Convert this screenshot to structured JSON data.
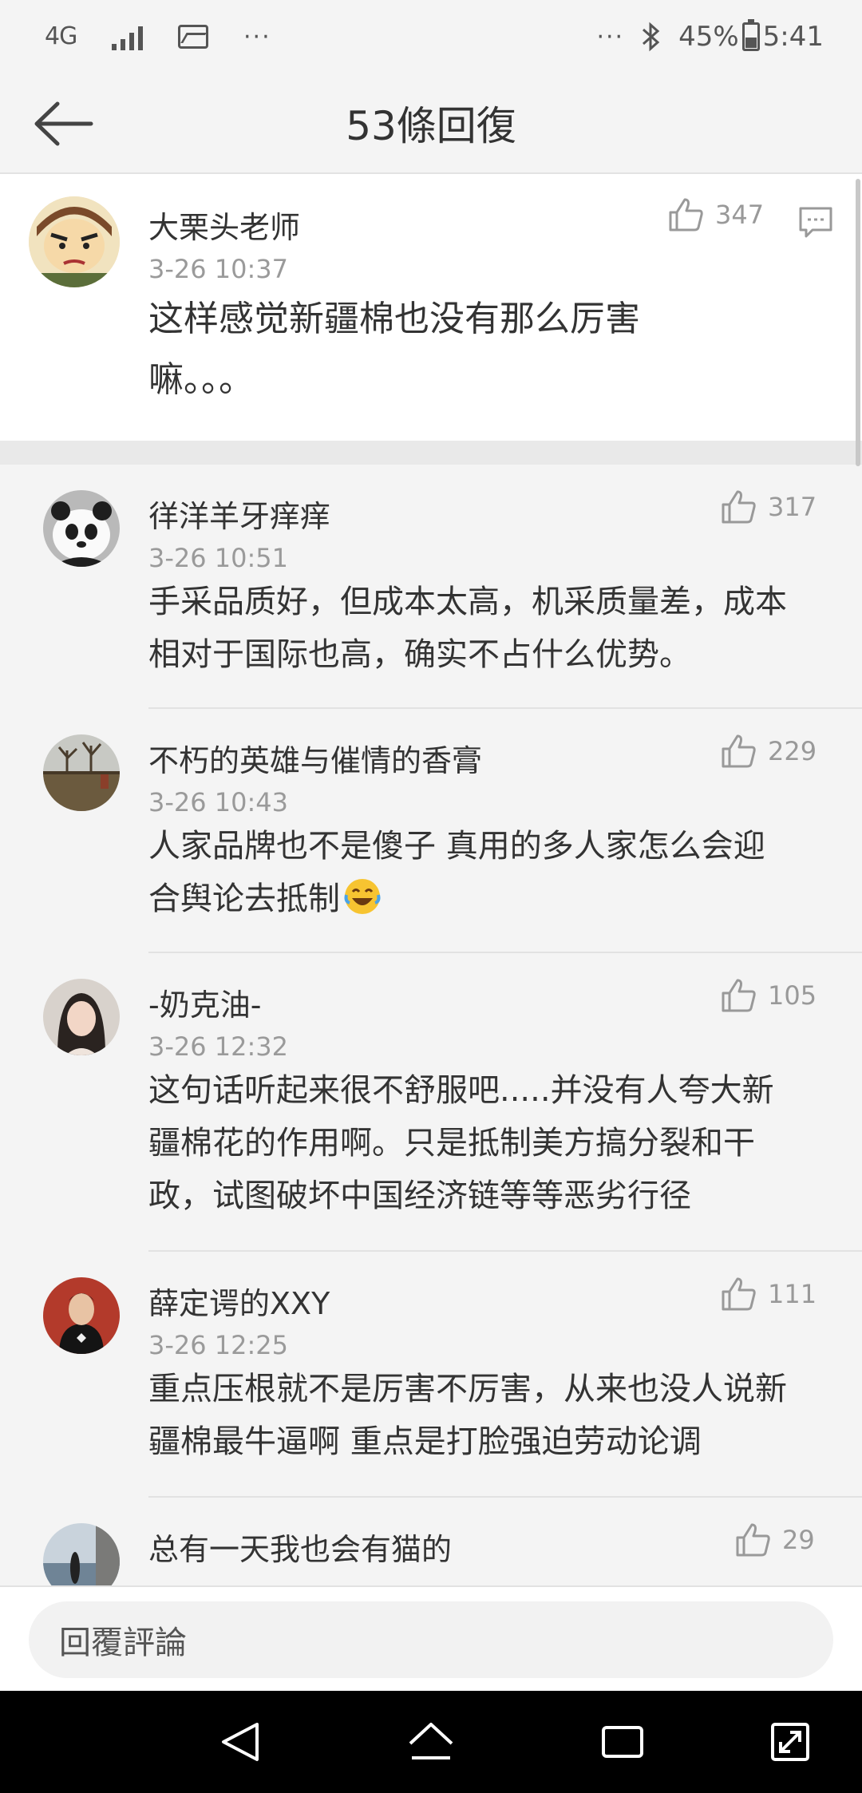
{
  "status_bar": {
    "network": "4G",
    "more": "···",
    "right_more": "···",
    "battery": "45%",
    "time": "5:41"
  },
  "header": {
    "title": "53條回復"
  },
  "top_comment": {
    "user": "大栗头老师",
    "time": "3-26 10:37",
    "likes": "347",
    "text_line1": "这样感觉新疆棉也没有那么厉害",
    "text_line2": "嘛。。。"
  },
  "replies": [
    {
      "user": "徉洋羊牙痒痒",
      "time": "3-26 10:51",
      "likes": "317",
      "lines": [
        "手采品质好，但成本太高，机采质量差，成本",
        "相对于国际也高，确实不占什么优势。"
      ]
    },
    {
      "user": "不朽的英雄与催情的香膏",
      "time": "3-26 10:43",
      "likes": "229",
      "lines": [
        "人家品牌也不是傻子  真用的多人家怎么会迎",
        "合舆论去抵制"
      ]
    },
    {
      "user": "-奶克油-",
      "time": "3-26 12:32",
      "likes": "105",
      "lines": [
        "这句话听起来很不舒服吧.....并没有人夸大新",
        "疆棉花的作用啊。只是抵制美方搞分裂和干",
        "政，试图破坏中国经济链等等恶劣行径"
      ]
    },
    {
      "user": "薛定谔的XXY",
      "time": "3-26 12:25",
      "likes": "111",
      "lines": [
        "重点压根就不是厉害不厉害，从来也没人说新",
        "疆棉最牛逼啊 重点是打脸强迫劳动论调"
      ]
    },
    {
      "user": "总有一天我也会有猫的",
      "likes": "29"
    }
  ],
  "reply_bar": {
    "placeholder": "回覆評論"
  }
}
